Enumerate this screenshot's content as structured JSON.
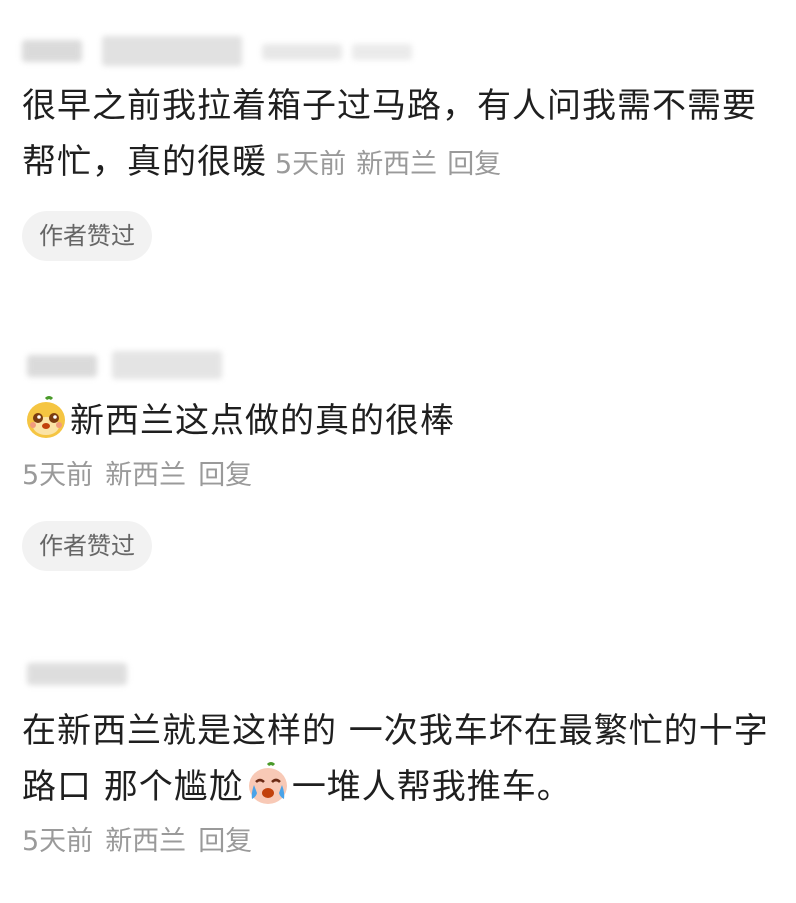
{
  "comments": [
    {
      "text": "很早之前我拉着箱子过马路，有人问我需不需要帮忙，真的很暖",
      "time": "5天前",
      "location": "新西兰",
      "reply_label": "回复",
      "liked_tag": "作者赞过"
    },
    {
      "emoji": "smiling-face-emoji",
      "text": "新西兰这点做的真的很棒",
      "time": "5天前",
      "location": "新西兰",
      "reply_label": "回复",
      "liked_tag": "作者赞过"
    },
    {
      "text_before": "在新西兰就是这样的 一次我车坏在最繁忙的十字路口 那个尴尬",
      "emoji": "crying-face-emoji",
      "text_after": "一堆人帮我推车。",
      "time": "5天前",
      "location": "新西兰",
      "reply_label": "回复"
    }
  ]
}
